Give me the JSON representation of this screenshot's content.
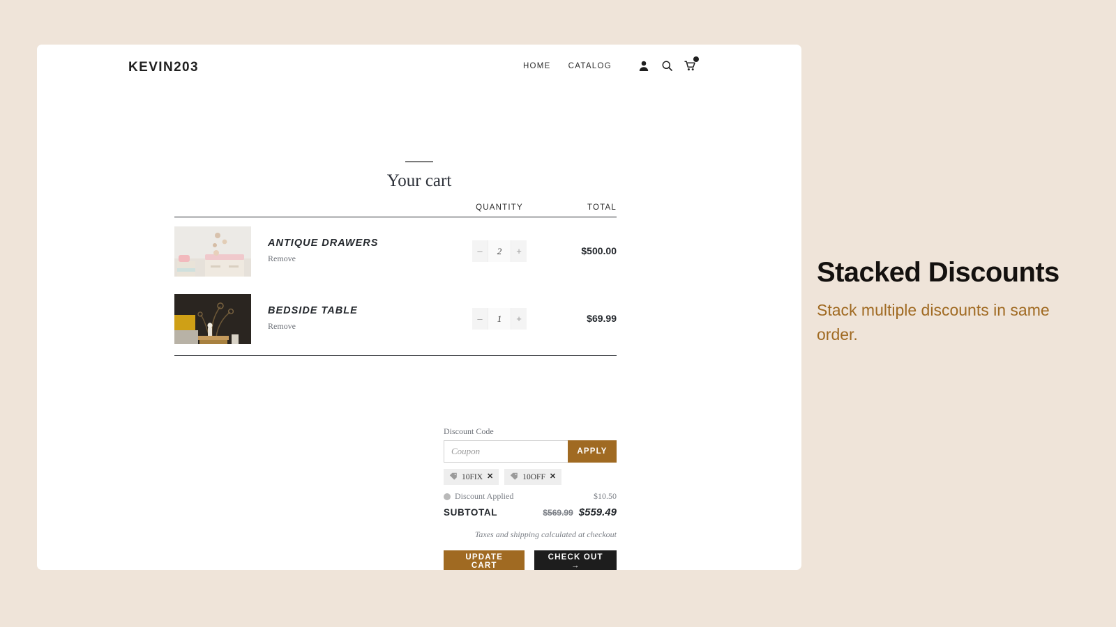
{
  "annotation": {
    "title": "Stacked Discounts",
    "subtitle": "Stack multiple discounts in same order.",
    "accent_color": "#a06a22",
    "title_color": "#14110f"
  },
  "page_background": "#efe4d9",
  "store": {
    "brand": "KEVIN203",
    "nav": [
      {
        "label": "HOME",
        "name": "nav-home"
      },
      {
        "label": "CATALOG",
        "name": "nav-catalog"
      }
    ],
    "icons": [
      {
        "name": "account-icon",
        "glyph": "person"
      },
      {
        "name": "search-icon",
        "glyph": "magnifier"
      },
      {
        "name": "cart-icon",
        "glyph": "cart",
        "badge": true
      }
    ],
    "page_title": "Your cart",
    "table": {
      "headers": {
        "quantity": "QUANTITY",
        "total": "TOTAL"
      },
      "rows": [
        {
          "title": "ANTIQUE DRAWERS",
          "remove_label": "Remove",
          "quantity": "2",
          "decrement": "–",
          "increment": "+",
          "line_total": "$500.00",
          "image_alt": "antique-drawers-thumbnail"
        },
        {
          "title": "BEDSIDE TABLE",
          "remove_label": "Remove",
          "quantity": "1",
          "decrement": "–",
          "increment": "+",
          "line_total": "$69.99",
          "image_alt": "bedside-table-thumbnail"
        }
      ]
    },
    "totals": {
      "discount_code_label": "Discount Code",
      "coupon_placeholder": "Coupon",
      "coupon_value": "",
      "apply_label": "APPLY",
      "chips": [
        {
          "code": "10FIX",
          "remove": "✕"
        },
        {
          "code": "10OFF",
          "remove": "✕"
        }
      ],
      "discount_applied_label": "Discount Applied",
      "discount_applied_amount": "$10.50",
      "subtotal_label": "SUBTOTAL",
      "subtotal_original": "$569.99",
      "subtotal_final": "$559.49",
      "tax_note": "Taxes and shipping calculated at checkout",
      "update_label": "UPDATE CART",
      "checkout_label": "CHECK OUT →",
      "apply_button_color": "#a06a22",
      "checkout_button_color": "#1d1d1d"
    }
  }
}
